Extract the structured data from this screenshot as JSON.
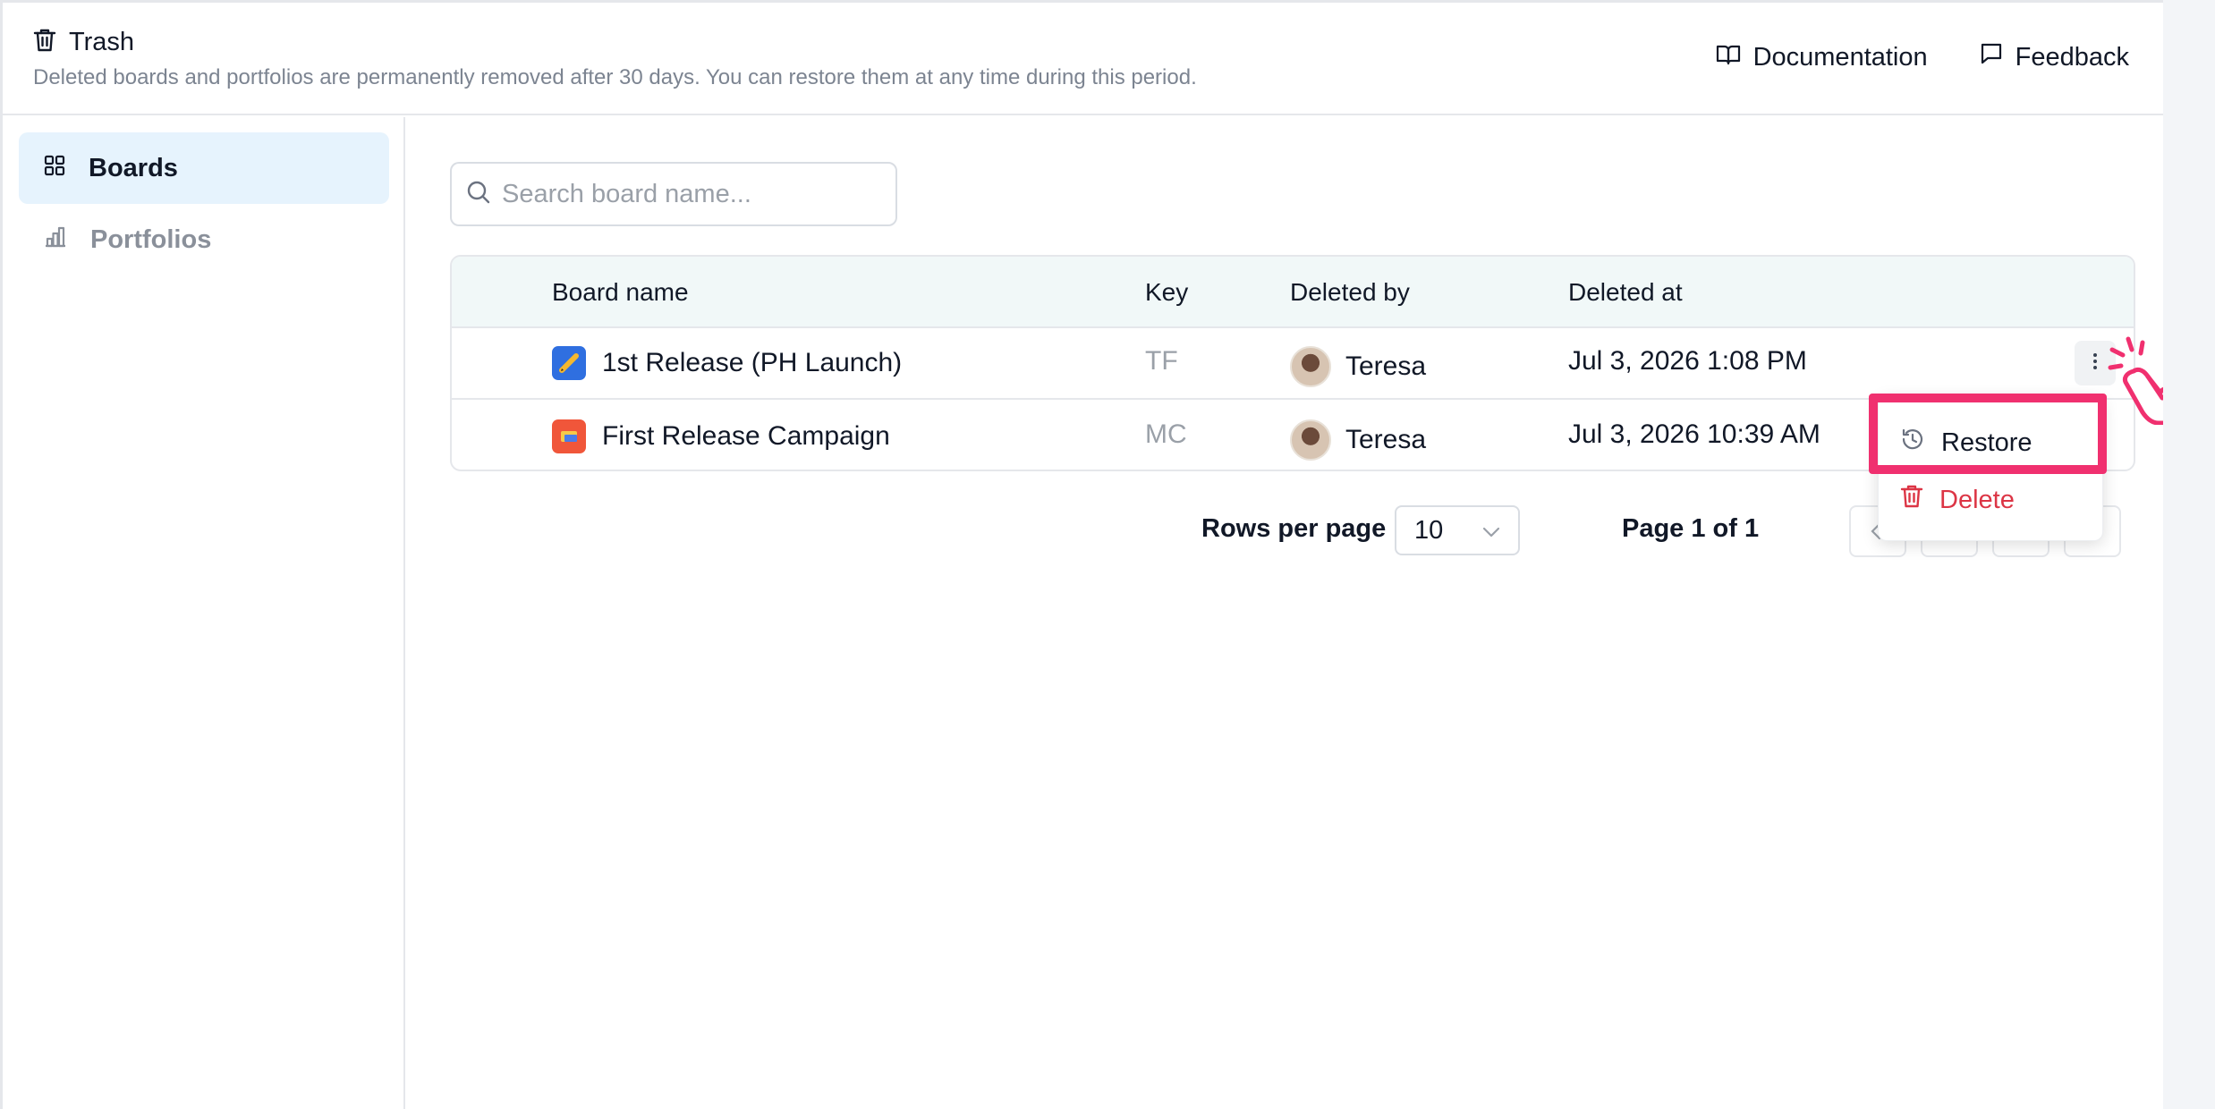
{
  "header": {
    "title": "Trash",
    "description": "Deleted boards and portfolios are permanently removed after 30 days. You can restore them at any time during this period.",
    "documentation_label": "Documentation",
    "feedback_label": "Feedback"
  },
  "sidebar": {
    "items": [
      {
        "label": "Boards",
        "icon": "grid-icon",
        "active": true
      },
      {
        "label": "Portfolios",
        "icon": "bar-chart-icon",
        "active": false
      }
    ]
  },
  "search": {
    "placeholder": "Search board name...",
    "value": ""
  },
  "table": {
    "columns": [
      "Board name",
      "Key",
      "Deleted by",
      "Deleted at"
    ],
    "rows": [
      {
        "name": "1st Release (PH Launch)",
        "key": "TF",
        "deleted_by": "Teresa",
        "deleted_at": "Jul 3, 2026 1:08 PM",
        "icon_color": "#2f6fe0"
      },
      {
        "name": "First Release Campaign",
        "key": "MC",
        "deleted_by": "Teresa",
        "deleted_at": "Jul 3, 2026 10:39 AM",
        "icon_color": "#f0563a"
      }
    ]
  },
  "pagination": {
    "rows_per_page_label": "Rows per page",
    "rows_per_page_value": "10",
    "page_label": "Page 1 of 1"
  },
  "menu": {
    "restore_label": "Restore",
    "delete_label": "Delete"
  },
  "colors": {
    "accent_highlight": "#f0306f",
    "delete": "#dc3545",
    "active_sidebar": "#e6f3fd"
  }
}
